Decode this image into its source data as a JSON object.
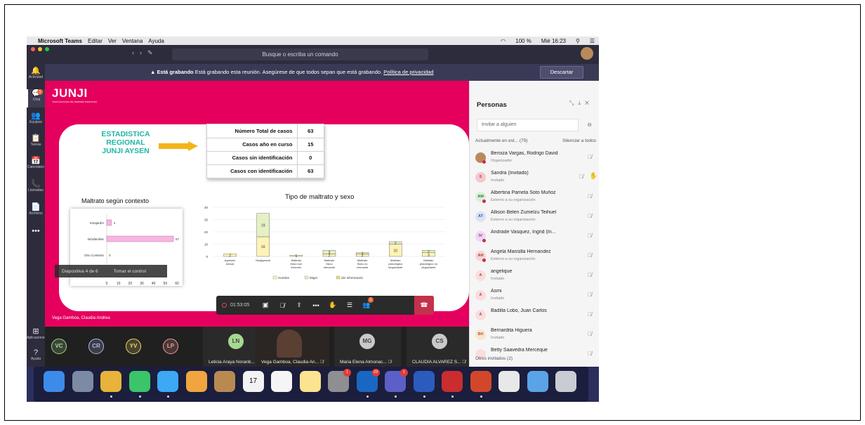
{
  "menubar": {
    "apple": "",
    "app": "Microsoft Teams",
    "items": [
      "Editar",
      "Ver",
      "Ventana",
      "Ayuda"
    ],
    "battery": "100 %",
    "datetime": "Mié 16:23"
  },
  "titlebar": {
    "search_placeholder": "Busque o escriba un comando",
    "back": "‹",
    "forward": "›"
  },
  "rail": [
    {
      "label": "Actividad",
      "icon": "bell-icon",
      "glyph": "🔔"
    },
    {
      "label": "Chat",
      "icon": "chat-icon",
      "glyph": "💬",
      "badge": "1"
    },
    {
      "label": "Equipos",
      "icon": "teams-icon",
      "glyph": "👥"
    },
    {
      "label": "Tareas",
      "icon": "tasks-icon",
      "glyph": "📋"
    },
    {
      "label": "Calendario",
      "icon": "calendar-icon",
      "glyph": "📅"
    },
    {
      "label": "Llamadas",
      "icon": "phone-icon",
      "glyph": "📞"
    },
    {
      "label": "Archivos",
      "icon": "files-icon",
      "glyph": "📄"
    },
    {
      "label": "...",
      "icon": "more-icon",
      "glyph": "•••"
    },
    {
      "label": "Aplicaciones",
      "icon": "apps-icon",
      "glyph": "⊞"
    },
    {
      "label": "Ayuda",
      "icon": "help-icon",
      "glyph": "?"
    }
  ],
  "recording": {
    "bold": "Está grabando",
    "text": " Está grabando esta reunión. Asegúrese de que todos sepan que está grabando. ",
    "link": "Política de privacidad",
    "dismiss": "Descartar"
  },
  "slide": {
    "logo": "JUNJI",
    "logo_sub": "JUNTA NACIONAL DE JARDINES INFANTILES",
    "heading_lines": [
      "ESTADISTICA",
      "REGIONAL",
      "JUNJI AYSEN"
    ],
    "table": [
      {
        "label": "Número Total de casos",
        "value": "63"
      },
      {
        "label": "Casos año en curso",
        "value": "15"
      },
      {
        "label": "Casos sin identificación",
        "value": "0"
      },
      {
        "label": "Casos con identificación",
        "value": "63"
      }
    ],
    "chart1_title": "Maltrato según contexto",
    "chart2_title": "Tipo de maltrato y sexo",
    "presenter": "Vega Gamboa, Claudia Andrea"
  },
  "chart_data": [
    {
      "type": "bar",
      "orientation": "horizontal",
      "title": "Maltrato según contexto",
      "categories": [
        "Intrajardín",
        "Intrafamiliar",
        "Otro Contexto"
      ],
      "values": [
        4,
        57,
        0
      ],
      "xlim": [
        0,
        60
      ],
      "xticks": [
        0,
        10,
        20,
        30,
        40,
        50,
        60
      ],
      "color": "#f7b6e0"
    },
    {
      "type": "bar",
      "stacked": true,
      "title": "Tipo de maltrato y sexo",
      "categories": [
        "Agresión sexual",
        "Negligencia",
        "Maltrato físico con lesiones",
        "Maltrato físico relevante",
        "Maltrato físico no relevante",
        "Maltrato psicológico degradante",
        "Maltrato psicológico no degradante"
      ],
      "series": [
        {
          "name": "Hombre",
          "values": [
            2,
            16,
            1,
            2,
            2,
            10,
            3
          ],
          "color": "#fdf3b4"
        },
        {
          "name": "Mujer",
          "values": [
            0,
            19,
            0,
            3,
            1,
            2,
            2
          ],
          "color": "#e3f1c4"
        },
        {
          "name": "Sin información",
          "values": [
            0,
            0,
            0,
            0,
            0,
            0,
            0
          ],
          "color": "#f4d57c"
        }
      ],
      "ylim": [
        0,
        40
      ],
      "yticks": [
        0,
        10,
        20,
        30,
        40
      ],
      "legend": "bottom"
    }
  ],
  "slide_overlay": {
    "slide": "Diapositiva 4 de 6",
    "take": "Tomar el control"
  },
  "controls": {
    "timer": "01:53:05",
    "badge": "1"
  },
  "thumbnails": [
    {
      "initials": "VC",
      "color": "#a7d88f"
    },
    {
      "initials": "CR",
      "color": "#a9b8e8"
    },
    {
      "initials": "YV",
      "color": "#f1d36a"
    },
    {
      "initials": "LP",
      "color": "#f19a9a"
    },
    {
      "initials": "LN",
      "color": "#a7d88f",
      "name": "Leticia Araya Noranb..."
    },
    {
      "initials": "",
      "name": "Vega Gamboa, Claudia An..."
    },
    {
      "initials": "MG",
      "color": "#c9c9c9",
      "name": "Maria Elena Almonac..."
    },
    {
      "initials": "CS",
      "color": "#c9c9c9",
      "name": "CLAUDIA ALVAREZ S..."
    }
  ],
  "people": {
    "title": "Personas",
    "invite_placeholder": "Invitar a alguien",
    "current": "Actualmente en est... (79)",
    "mute_all": "Silenciar a todos",
    "list": [
      {
        "initials": "",
        "name": "Beroiza Vargas, Rodrigo David",
        "role": "Organizador",
        "bg": "#b98a5b",
        "fg": "#fff"
      },
      {
        "initials": "S",
        "name": "Sandra (Invitado)",
        "role": "Invitado",
        "bg": "#f7c7cf",
        "fg": "#b23a55",
        "hand": "✋"
      },
      {
        "initials": "AM",
        "name": "Albertina Pamela Soto Muñoz",
        "role": "Externo a su organización",
        "bg": "#dceedc",
        "fg": "#2d7a3a"
      },
      {
        "initials": "AT",
        "name": "Allison Belen Zumelzu Teihuel",
        "role": "Externo a su organización",
        "bg": "#dbe2f7",
        "fg": "#3d4ea6"
      },
      {
        "initials": "IV",
        "name": "Andrade Vasquez, Ingrid (In...",
        "role": "",
        "bg": "#f0d6f2",
        "fg": "#8b2a92"
      },
      {
        "initials": "AH",
        "name": "Angela Mansilla Hernandez",
        "role": "Externo a su organización",
        "bg": "#f7d6d6",
        "fg": "#a33"
      },
      {
        "initials": "A",
        "name": "angelique",
        "role": "Invitado",
        "bg": "#f9dede",
        "fg": "#b23a55"
      },
      {
        "initials": "A",
        "name": "Asmi",
        "role": "Invitado",
        "bg": "#f9dede",
        "fg": "#b23a55"
      },
      {
        "initials": "A",
        "name": "Badilla Lobo, Juan Carlos",
        "role": "",
        "bg": "#f9dede",
        "fg": "#b23a55"
      },
      {
        "initials": "BH",
        "name": "Bernardita Higuera",
        "role": "Invitado",
        "bg": "#fbe3d3",
        "fg": "#b25a2a"
      },
      {
        "initials": "",
        "name": "Betty Saavedra Merceque",
        "role": "",
        "bg": "#f9dede",
        "fg": "#b23a55"
      }
    ],
    "guests": "Otros invitados (2)"
  },
  "dock": [
    {
      "icon": "finder-icon",
      "color": "#3d8be8"
    },
    {
      "icon": "launchpad-icon",
      "color": "#7c8aa3"
    },
    {
      "icon": "chrome-icon",
      "color": "#e8b33a"
    },
    {
      "icon": "facetime-icon",
      "color": "#3cc46a"
    },
    {
      "icon": "messages-icon",
      "color": "#3da8f3"
    },
    {
      "icon": "photos-icon",
      "color": "#f0a540"
    },
    {
      "icon": "contacts-icon",
      "color": "#b88a52"
    },
    {
      "icon": "calendar-icon",
      "color": "#f2f2f2",
      "label": "17"
    },
    {
      "icon": "reminders-icon",
      "color": "#f5f5f5"
    },
    {
      "icon": "notes-icon",
      "color": "#fbe38f"
    },
    {
      "icon": "system-preferences-icon",
      "color": "#8e8e93",
      "badge": "1"
    },
    {
      "icon": "outlook-icon",
      "color": "#1967c2",
      "badge": "23"
    },
    {
      "icon": "teams-icon",
      "color": "#5b5fc7",
      "badge": "1"
    },
    {
      "icon": "word-icon",
      "color": "#2b5cbd"
    },
    {
      "icon": "acrobat-icon",
      "color": "#c92d2d"
    },
    {
      "icon": "powerpoint-icon",
      "color": "#d2472b"
    },
    {
      "icon": "preview-icon",
      "color": "#e8e8e8"
    },
    {
      "icon": "screen-icon",
      "color": "#5aa3e6"
    },
    {
      "icon": "trash-icon",
      "color": "#c9ccd2"
    }
  ]
}
